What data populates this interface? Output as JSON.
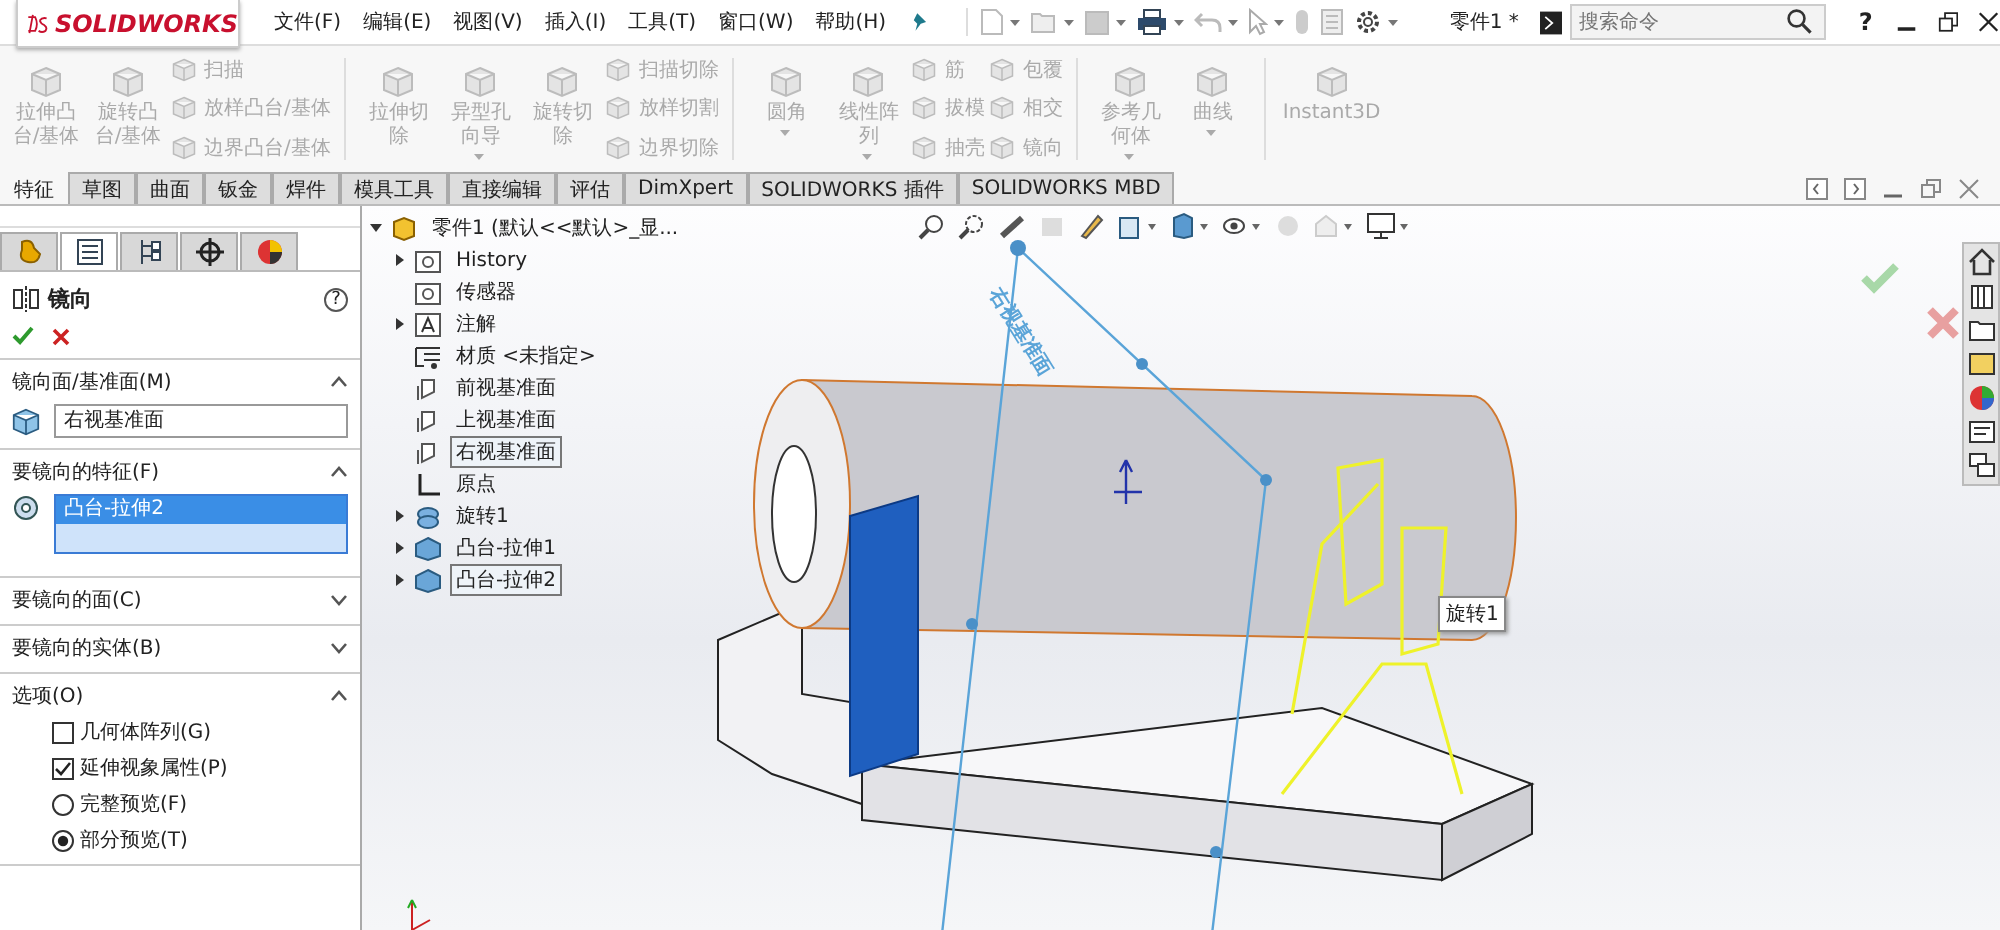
{
  "app": {
    "logo": "SOLIDWORKS"
  },
  "menu": [
    "文件(F)",
    "编辑(E)",
    "视图(V)",
    "插入(I)",
    "工具(T)",
    "窗口(W)",
    "帮助(H)"
  ],
  "document_title": "零件1 *",
  "search": {
    "placeholder": "搜索命令"
  },
  "help": "?",
  "ribbon": {
    "disabled": true,
    "items": [
      {
        "kind": "large",
        "label": "拉伸凸台/基体",
        "dropdown": false
      },
      {
        "kind": "large",
        "label": "旋转凸台/基体",
        "dropdown": false
      },
      {
        "kind": "stack",
        "items": [
          "扫描",
          "放样凸台/基体",
          "边界凸台/基体"
        ]
      },
      {
        "kind": "separator"
      },
      {
        "kind": "large",
        "label": "拉伸切除",
        "dropdown": false
      },
      {
        "kind": "large",
        "label": "异型孔向导",
        "dropdown": true
      },
      {
        "kind": "large",
        "label": "旋转切除",
        "dropdown": false
      },
      {
        "kind": "stack",
        "items": [
          "扫描切除",
          "放样切割",
          "边界切除"
        ]
      },
      {
        "kind": "separator"
      },
      {
        "kind": "large",
        "label": "圆角",
        "dropdown": true
      },
      {
        "kind": "large",
        "label": "线性阵列",
        "dropdown": true
      },
      {
        "kind": "stack",
        "items": [
          "筋",
          "拔模",
          "抽壳"
        ]
      },
      {
        "kind": "stack",
        "items": [
          "包覆",
          "相交",
          "镜向"
        ]
      },
      {
        "kind": "separator"
      },
      {
        "kind": "large",
        "label": "参考几何体",
        "dropdown": true
      },
      {
        "kind": "large",
        "label": "曲线",
        "dropdown": true
      },
      {
        "kind": "separator"
      },
      {
        "kind": "large",
        "label": "Instant3D",
        "dropdown": false
      }
    ]
  },
  "tabs": [
    {
      "label": "特征",
      "selected": true
    },
    {
      "label": "草图",
      "selected": false
    },
    {
      "label": "曲面",
      "selected": false
    },
    {
      "label": "钣金",
      "selected": false
    },
    {
      "label": "焊件",
      "selected": false
    },
    {
      "label": "模具工具",
      "selected": false
    },
    {
      "label": "直接编辑",
      "selected": false
    },
    {
      "label": "评估",
      "selected": false
    },
    {
      "label": "DimXpert",
      "selected": false
    },
    {
      "label": "SOLIDWORKS 插件",
      "selected": false
    },
    {
      "label": "SOLIDWORKS MBD",
      "selected": false
    }
  ],
  "panel_tabs": [
    {
      "selected": false
    },
    {
      "selected": true
    },
    {
      "selected": false
    },
    {
      "selected": false
    },
    {
      "selected": false
    }
  ],
  "property_manager": {
    "title": "镜向",
    "help": "?",
    "sections": [
      {
        "kind": "field",
        "title": "镜向面/基准面(M)",
        "expanded": true,
        "value": "右视基准面"
      },
      {
        "kind": "list",
        "title": "要镜向的特征(F)",
        "expanded": true,
        "items": [
          {
            "label": "凸台-拉伸2",
            "selected": true
          }
        ]
      },
      {
        "kind": "plain",
        "title": "要镜向的面(C)",
        "expanded": false
      },
      {
        "kind": "plain",
        "title": "要镜向的实体(B)",
        "expanded": false
      },
      {
        "kind": "options",
        "title": "选项(O)",
        "expanded": true,
        "options": [
          {
            "kind": "checkbox",
            "label": "几何体阵列(G)",
            "checked": false
          },
          {
            "kind": "checkbox",
            "label": "延伸视象属性(P)",
            "checked": true
          },
          {
            "kind": "radio",
            "label": "完整预览(F)",
            "selected": false
          },
          {
            "kind": "radio",
            "label": "部分预览(T)",
            "selected": true
          }
        ]
      }
    ]
  },
  "tree": {
    "root": "零件1  (默认<<默认>_显...",
    "items": [
      {
        "kind": "history",
        "label": "History",
        "expandable": true,
        "selected": false
      },
      {
        "kind": "sensor",
        "label": "传感器",
        "expandable": false,
        "selected": false
      },
      {
        "kind": "annotation",
        "label": "注解",
        "expandable": true,
        "selected": false
      },
      {
        "kind": "material",
        "label": "材质 <未指定>",
        "expandable": false,
        "selected": false
      },
      {
        "kind": "plane",
        "label": "前视基准面",
        "expandable": false,
        "selected": false
      },
      {
        "kind": "plane",
        "label": "上视基准面",
        "expandable": false,
        "selected": false
      },
      {
        "kind": "plane",
        "label": "右视基准面",
        "expandable": false,
        "selected": true
      },
      {
        "kind": "origin",
        "label": "原点",
        "expandable": false,
        "selected": false
      },
      {
        "kind": "revolve",
        "label": "旋转1",
        "expandable": true,
        "selected": false
      },
      {
        "kind": "extrude",
        "label": "凸台-拉伸1",
        "expandable": true,
        "selected": false
      },
      {
        "kind": "extrude",
        "label": "凸台-拉伸2",
        "expandable": true,
        "selected": true
      }
    ]
  },
  "viewport": {
    "plane_label": "右视基准面",
    "tooltip": "旋转1"
  }
}
